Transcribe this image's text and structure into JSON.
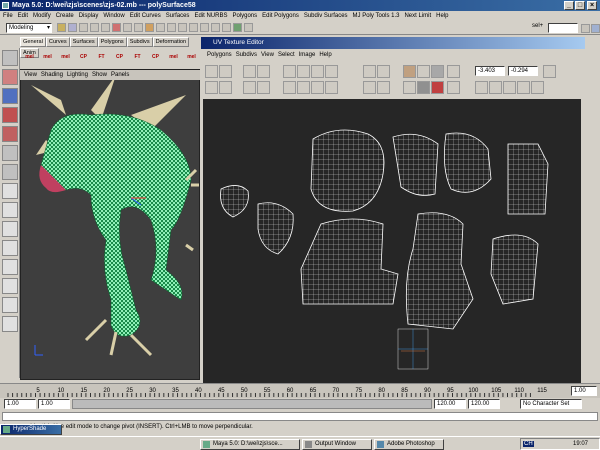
{
  "window": {
    "title": "Maya 5.0: D:\\wei\\zjs\\scenes\\zjs-02.mb  ---  polySurface58"
  },
  "menubar": [
    "File",
    "Edit",
    "Modify",
    "Create",
    "Display",
    "Window",
    "Edit Curves",
    "Surfaces",
    "Edit NURBS",
    "Polygons",
    "Edit Polygons",
    "Subdiv Surfaces",
    "MJ Poly Tools 1.3",
    "Next Limit",
    "Help"
  ],
  "status": {
    "mode": "Modeling",
    "sel_label": "sel+"
  },
  "shelf": {
    "tabs": [
      "General",
      "Curves",
      "Surfaces",
      "Polygons",
      "Subdivs",
      "Deformation",
      "Anim"
    ],
    "icons": [
      "mel",
      "mel",
      "mel",
      "CP",
      "FT",
      "CP",
      "FT",
      "CP",
      "mel",
      "mel",
      "mel"
    ]
  },
  "viewport": {
    "menu": [
      "View",
      "Shading",
      "Lighting",
      "Show",
      "Panels"
    ]
  },
  "uv_editor": {
    "title": "UV Texture Editor",
    "menu": [
      "Polygons",
      "Subdivs",
      "View",
      "Select",
      "Image",
      "Help"
    ],
    "u_value": "-3.403",
    "v_value": "-0.294"
  },
  "timeline": {
    "ticks": [
      "5",
      "10",
      "15",
      "20",
      "25",
      "30",
      "35",
      "40",
      "45",
      "50",
      "55",
      "60",
      "65",
      "70",
      "75",
      "80",
      "85",
      "90",
      "95",
      "100",
      "105",
      "110",
      "115"
    ],
    "current": "1.00"
  },
  "range": {
    "start": "1.00",
    "inner_start": "1.00",
    "inner_end": "120.00",
    "end": "120.00",
    "char_set": "No Character Set"
  },
  "helpline": "to move object(s). Use edit mode to change pivot (INSERT). Ctrl+LMB to move perpendicular.",
  "taskbar": {
    "start_label": "HyperShade",
    "tasks": [
      "Maya 5.0: D:\\wei\\zjs\\sce...",
      "Output Window",
      "Adobe Photoshop"
    ],
    "clock": "19:07",
    "lang": "CH"
  },
  "colors": {
    "accent": "#0a246a",
    "viewport_bg": "#3e3e3e",
    "uv_bg": "#262626",
    "mesh": "#2fbf6a",
    "horn": "#d9cfa8"
  }
}
